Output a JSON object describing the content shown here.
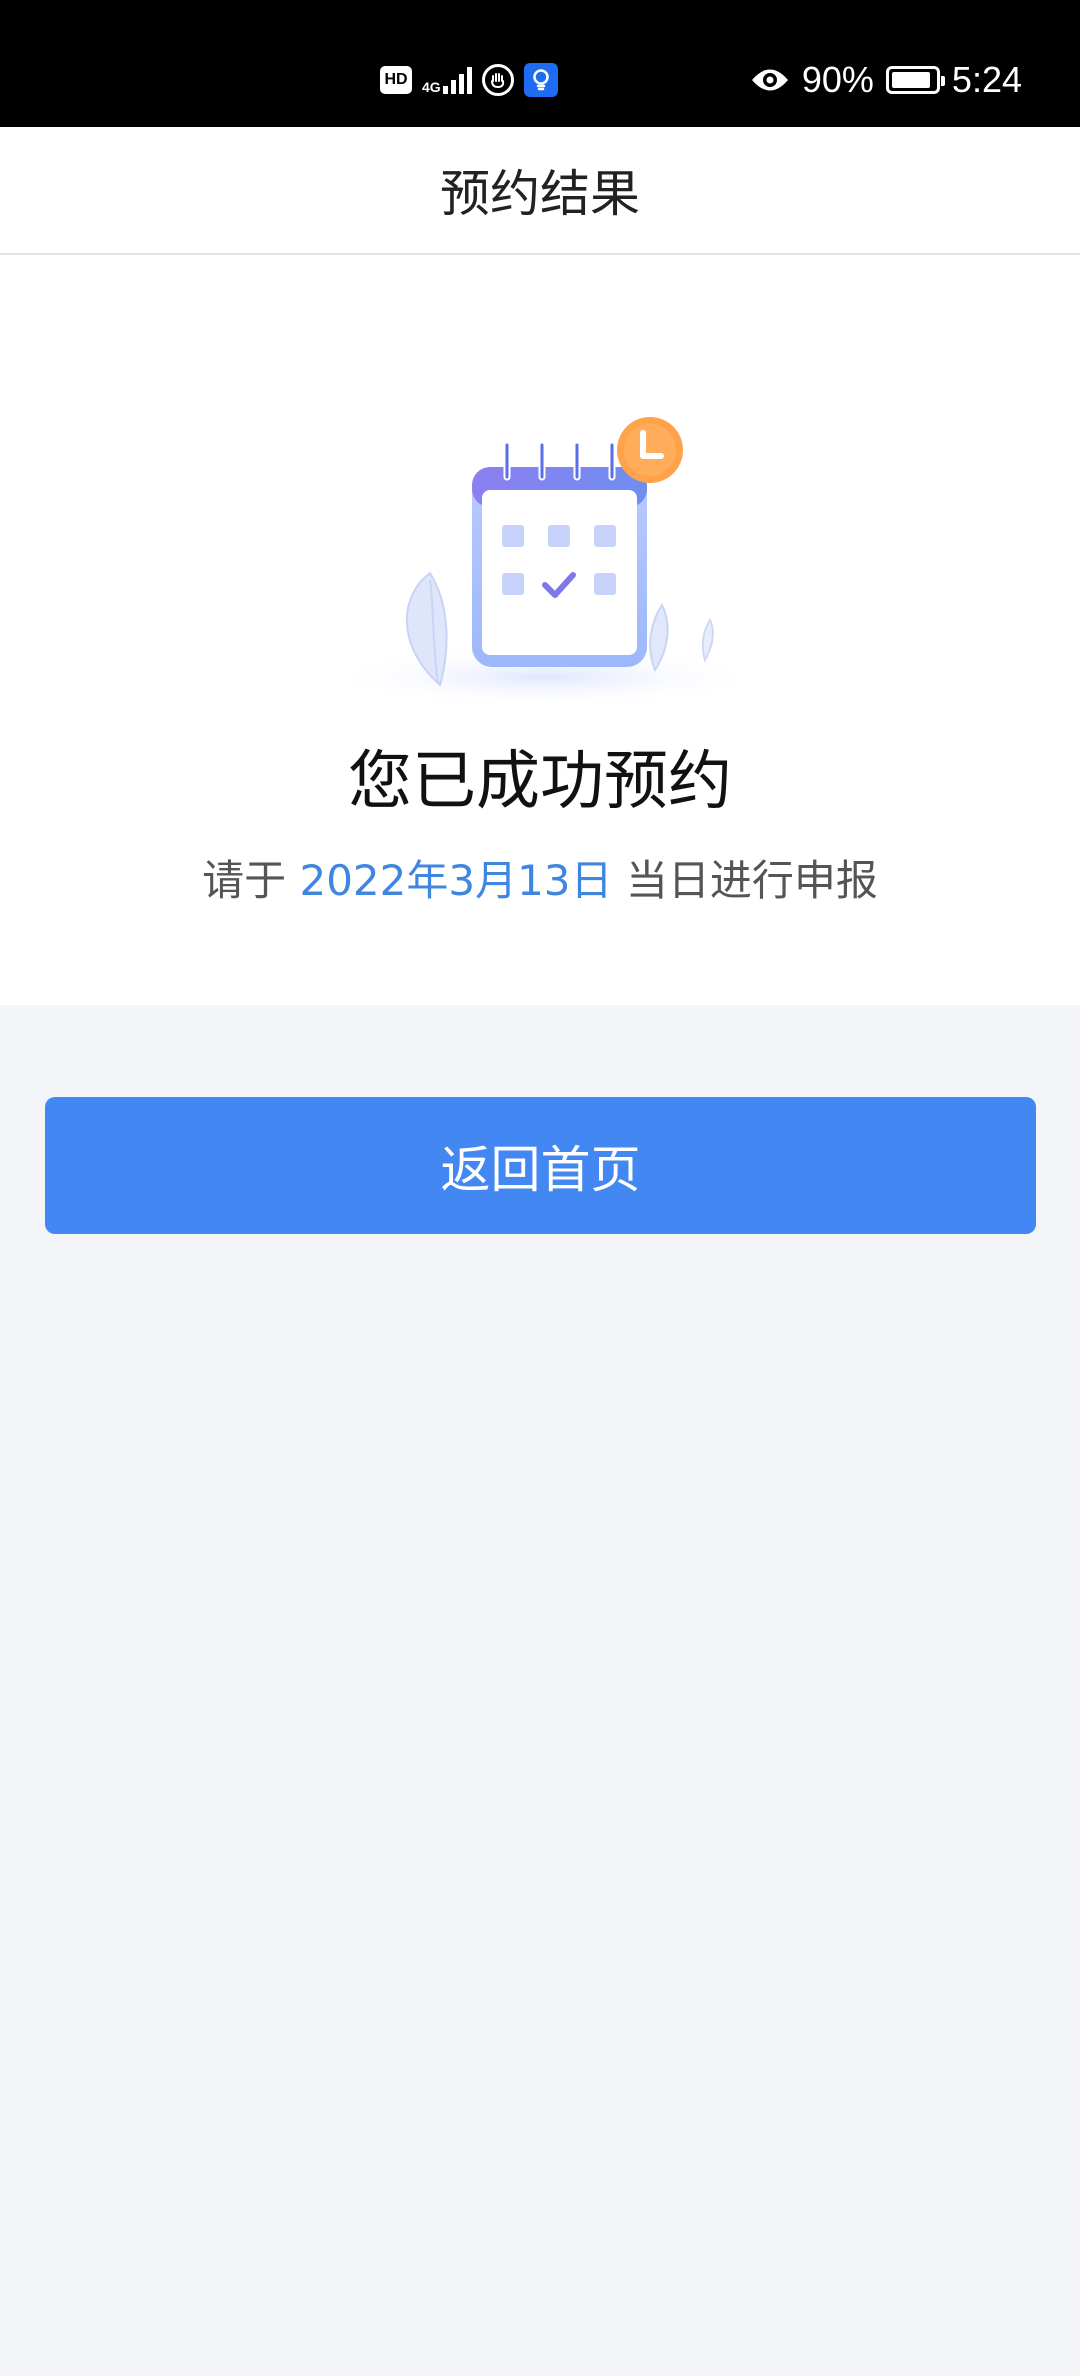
{
  "status_bar": {
    "hd_label": "HD",
    "network_label": "4G",
    "battery_percent": "90%",
    "battery_level": 0.9,
    "time": "5:24",
    "icons": [
      "hd-icon",
      "signal-icon",
      "gesture-icon",
      "bulb-icon",
      "eye-icon",
      "battery-icon"
    ]
  },
  "header": {
    "title": "预约结果"
  },
  "result": {
    "title": "您已成功预约",
    "sub_prefix": "请于",
    "date": "2022年3月13日",
    "sub_suffix": "当日进行申报",
    "illustration_icon": "calendar-clock-icon"
  },
  "actions": {
    "home_label": "返回首页"
  },
  "colors": {
    "accent": "#4287f2",
    "date_text": "#3f86e0",
    "background": "#f4f5f9",
    "clock_badge": "#ff9f43"
  }
}
